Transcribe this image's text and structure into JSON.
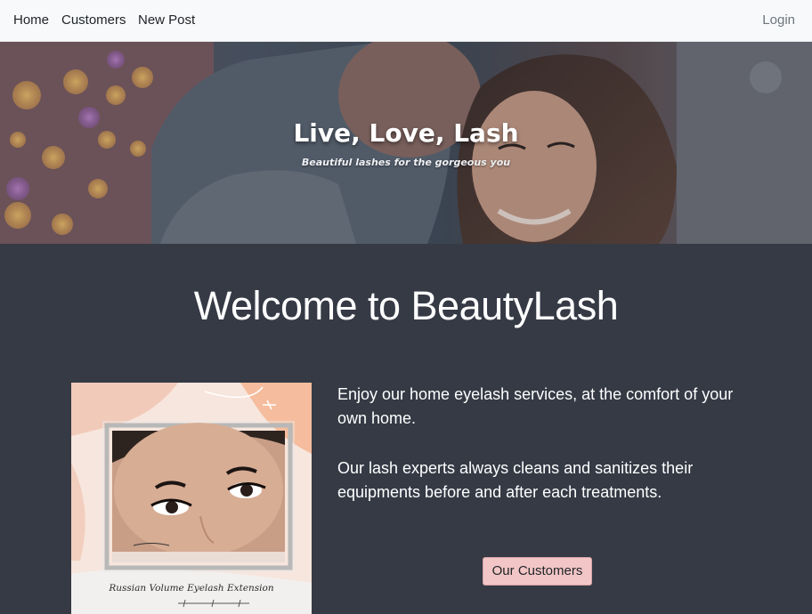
{
  "navbar": {
    "home": "Home",
    "customers": "Customers",
    "new_post": "New Post",
    "login": "Login"
  },
  "hero": {
    "title": "Live, Love, Lash",
    "subtitle": "Beautiful lashes for the gorgeous you"
  },
  "main": {
    "heading": "Welcome to BeautyLash",
    "paragraph1": "Enjoy our home eyelash services, at the comfort of your own home.",
    "paragraph2": "Our lash experts always cleans and sanitizes their equipments before and after each treatments.",
    "button": "Our Customers"
  },
  "promo_image": {
    "caption": "Russian Volume Eyelash Extension"
  },
  "colors": {
    "navbar_bg": "#f8f9fa",
    "page_bg": "#353a45",
    "button_bg": "#f2c6c6"
  }
}
